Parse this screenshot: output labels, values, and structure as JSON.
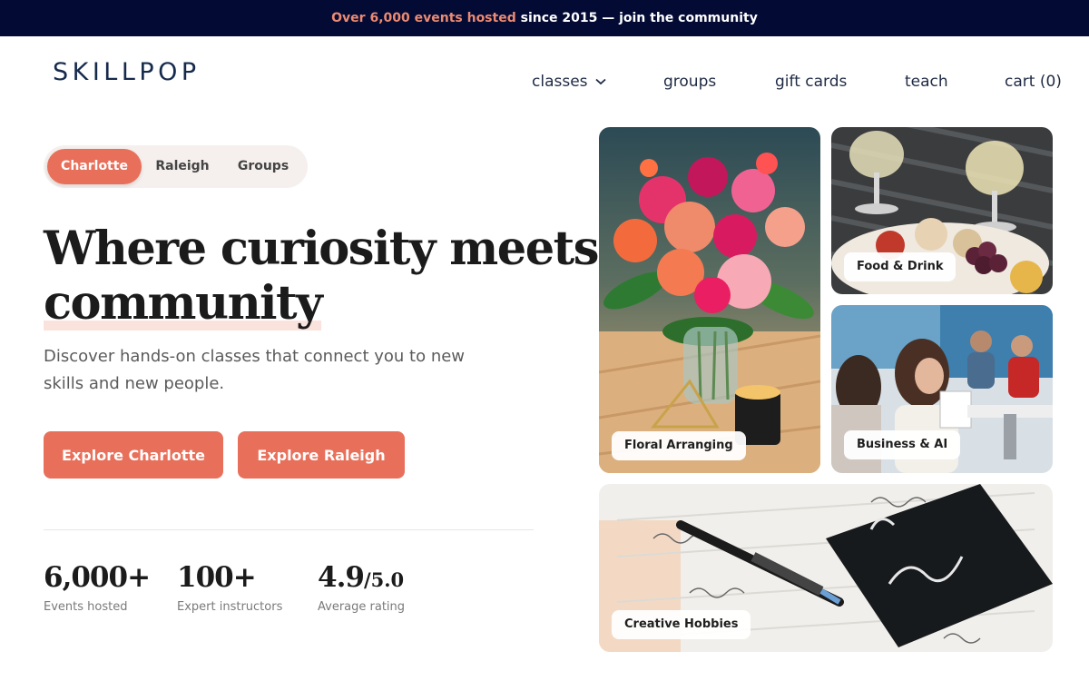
{
  "announcement": {
    "highlight": "Over 6,000 events hosted",
    "rest": " since 2015 — join the community"
  },
  "header": {
    "logo": "SKILLPOP",
    "nav": {
      "classes": "classes",
      "groups": "groups",
      "gift_cards": "gift cards",
      "teach": "teach",
      "cart": "cart (0)"
    }
  },
  "hero": {
    "toggle": [
      "Charlotte",
      "Raleigh",
      "Groups"
    ],
    "toggle_selected": "Charlotte",
    "headline_part1": "Where curiosity meets",
    "headline_part2": "community",
    "subtitle": "Discover hands-on classes that connect you to new skills and new people.",
    "cta_primary": "Explore Charlotte",
    "cta_secondary": "Explore Raleigh"
  },
  "stats": [
    {
      "value": "6,000+",
      "suffix": "",
      "label": "Events hosted"
    },
    {
      "value": "100+",
      "suffix": "",
      "label": "Expert instructors"
    },
    {
      "value": "4.9",
      "suffix": "/5.0",
      "label": "Average rating"
    }
  ],
  "categories": {
    "floral": "Floral Arranging",
    "food": "Food & Drink",
    "business": "Business & AI",
    "creative": "Creative Hobbies"
  },
  "colors": {
    "announcement_bg": "#030a33",
    "accent": "#e8705a",
    "highlight_text": "#eb8a72",
    "logo": "#162a4c"
  }
}
